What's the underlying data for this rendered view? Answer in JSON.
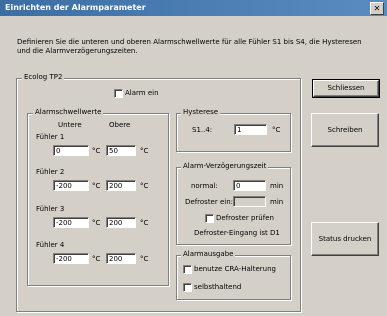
{
  "window": {
    "title": "Einrichten der Alarmparameter",
    "close_glyph": "✕"
  },
  "description": "Definieren Sie die unteren und oberen Alarmschwellwerte für alle Fühler S1 bis S4, die Hysteresen und die Alarmverzögerungszeiten.",
  "ecolog": {
    "title": "Ecolog TP2",
    "alarm_ein": {
      "label": "Alarm ein",
      "checked": false
    }
  },
  "schwellwerte": {
    "title": "Alarmschwellwerte",
    "col_lower": "Untere",
    "col_upper": "Obere",
    "unit": "°C",
    "sensors": [
      {
        "label": "Fühler 1",
        "lower": "0",
        "upper": "50"
      },
      {
        "label": "Fühler 2",
        "lower": "-200",
        "upper": "200"
      },
      {
        "label": "Fühler 3",
        "lower": "-200",
        "upper": "200"
      },
      {
        "label": "Fühler 4",
        "lower": "-200",
        "upper": "200"
      }
    ]
  },
  "hysterese": {
    "title": "Hysterese",
    "label": "S1..4:",
    "value": "1",
    "unit": "°C"
  },
  "verzoegerung": {
    "title": "Alarm-Verzögerungszeit",
    "normal_label": "normal:",
    "normal_value": "0",
    "defroster_label": "Defroster ein:",
    "defroster_value": "",
    "unit": "min",
    "defroster_pruefen": {
      "label": "Defroster prüfen",
      "checked": false
    },
    "defroster_eingang": "Defroster-Eingang ist D1"
  },
  "alarmausgabe": {
    "title": "Alarmausgabe",
    "option1": {
      "label": "benutze CRA-Halterung",
      "checked": false
    },
    "option2": {
      "label": "selbsthaltend",
      "checked": false
    }
  },
  "buttons": {
    "schliessen": "Schliessen",
    "schreiben": "Schreiben",
    "status_drucken": "Status drucken"
  }
}
